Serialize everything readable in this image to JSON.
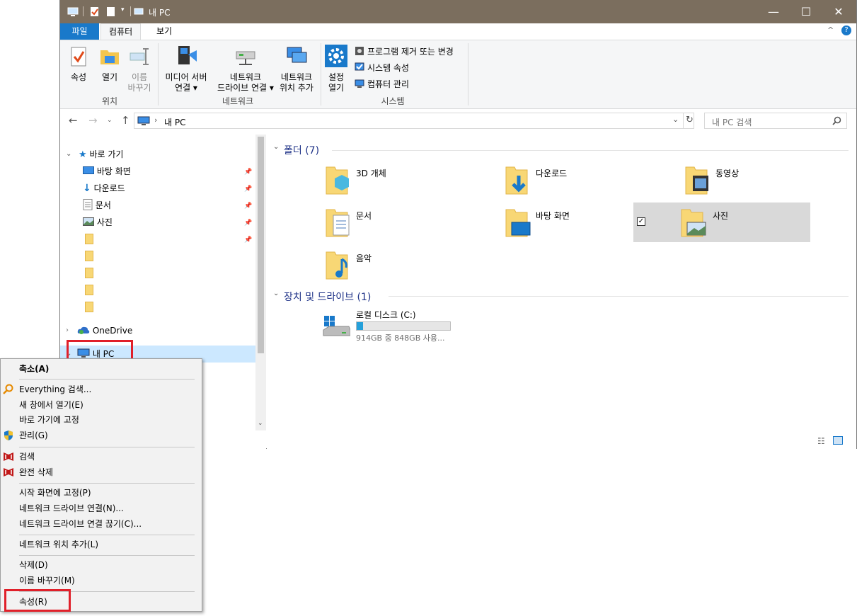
{
  "window": {
    "title": "내 PC",
    "controls": {
      "minimize": "—",
      "maximize": "☐",
      "close": "✕"
    },
    "titlebar_color": "#7b6e5e"
  },
  "ribbon_tabs": {
    "file": "파일",
    "computer": "컴퓨터",
    "view": "보기"
  },
  "ribbon": {
    "location_group": {
      "label": "위치",
      "properties": "속성",
      "open": "열기",
      "rename1": "이름",
      "rename2": "바꾸기"
    },
    "network_group": {
      "label": "네트워크",
      "media1": "미디어 서버",
      "media2": "연결 ▾",
      "map1": "네트워크",
      "map2": "드라이브 연결 ▾",
      "addloc1": "네트워크",
      "addloc2": "위치 추가"
    },
    "system_group": {
      "label": "시스템",
      "settings1": "설정",
      "settings2": "열기",
      "uninstall": "프로그램 제거 또는 변경",
      "sysprops": "시스템 속성",
      "manage": "컴퓨터 관리"
    }
  },
  "address": {
    "path": "내 PC",
    "search_placeholder": "내 PC 검색"
  },
  "nav": {
    "quick_access": "바로 가기",
    "items": [
      "바탕 화면",
      "다운로드",
      "문서",
      "사진"
    ],
    "onedrive": "OneDrive",
    "this_pc": "내 PC"
  },
  "folders_section": "폴더 (7)",
  "folders": [
    "3D 개체",
    "다운로드",
    "동영상",
    "문서",
    "바탕 화면",
    "사진",
    "음악"
  ],
  "drives_section": "장치 및 드라이브 (1)",
  "drive": {
    "name": "로컬 디스크 (C:)",
    "size_text": "914GB 중 848GB 사용...",
    "used_fraction": 0.07
  },
  "context_menu": {
    "collapse": "축소(A)",
    "everything": "Everything 검색...",
    "open_new_window": "새 창에서 열기(E)",
    "pin_quick": "바로 가기에 고정",
    "manage": "관리(G)",
    "scan": "검색",
    "shred": "완전 삭제",
    "pin_start": "시작 화면에 고정(P)",
    "map_drive": "네트워크 드라이브 연결(N)...",
    "disconnect": "네트워크 드라이브 연결 끊기(C)...",
    "add_netloc": "네트워크 위치 추가(L)",
    "delete": "삭제(D)",
    "rename": "이름 바꾸기(M)",
    "properties": "속성(R)"
  },
  "colors": {
    "accent": "#1979ca",
    "highlight": "#e0202a",
    "selection": "#cce8ff"
  }
}
